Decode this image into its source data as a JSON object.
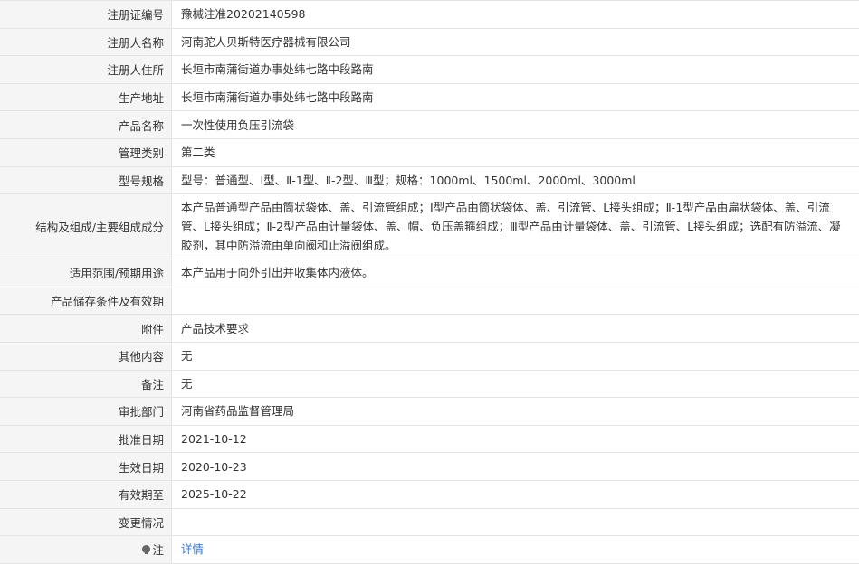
{
  "rows": [
    {
      "label": "注册证编号",
      "value": "豫械注准20202140598"
    },
    {
      "label": "注册人名称",
      "value": "河南驼人贝斯特医疗器械有限公司"
    },
    {
      "label": "注册人住所",
      "value": "长垣市南蒲街道办事处纬七路中段路南"
    },
    {
      "label": "生产地址",
      "value": "长垣市南蒲街道办事处纬七路中段路南"
    },
    {
      "label": "产品名称",
      "value": "一次性使用负压引流袋"
    },
    {
      "label": "管理类别",
      "value": "第二类"
    },
    {
      "label": "型号规格",
      "value": "型号：普通型、Ⅰ型、Ⅱ-1型、Ⅱ-2型、Ⅲ型；规格：1000ml、1500ml、2000ml、3000ml"
    },
    {
      "label": "结构及组成/主要组成成分",
      "value": "本产品普通型产品由筒状袋体、盖、引流管组成；Ⅰ型产品由筒状袋体、盖、引流管、L接头组成；Ⅱ-1型产品由扁状袋体、盖、引流管、L接头组成；Ⅱ-2型产品由计量袋体、盖、帽、负压盖箍组成；Ⅲ型产品由计量袋体、盖、引流管、L接头组成；选配有防溢流、凝胶剂，其中防溢流由单向阀和止溢阀组成。"
    },
    {
      "label": "适用范围/预期用途",
      "value": "本产品用于向外引出并收集体内液体。"
    },
    {
      "label": "产品储存条件及有效期",
      "value": ""
    },
    {
      "label": "附件",
      "value": "产品技术要求"
    },
    {
      "label": "其他内容",
      "value": "无"
    },
    {
      "label": "备注",
      "value": "无"
    },
    {
      "label": "审批部门",
      "value": "河南省药品监督管理局"
    },
    {
      "label": "批准日期",
      "value": "2021-10-12"
    },
    {
      "label": "生效日期",
      "value": "2020-10-23"
    },
    {
      "label": "有效期至",
      "value": "2025-10-22"
    },
    {
      "label": "变更情况",
      "value": ""
    }
  ],
  "note": {
    "label": "注",
    "link_text": "详情",
    "icon": "info-bulb-icon"
  }
}
